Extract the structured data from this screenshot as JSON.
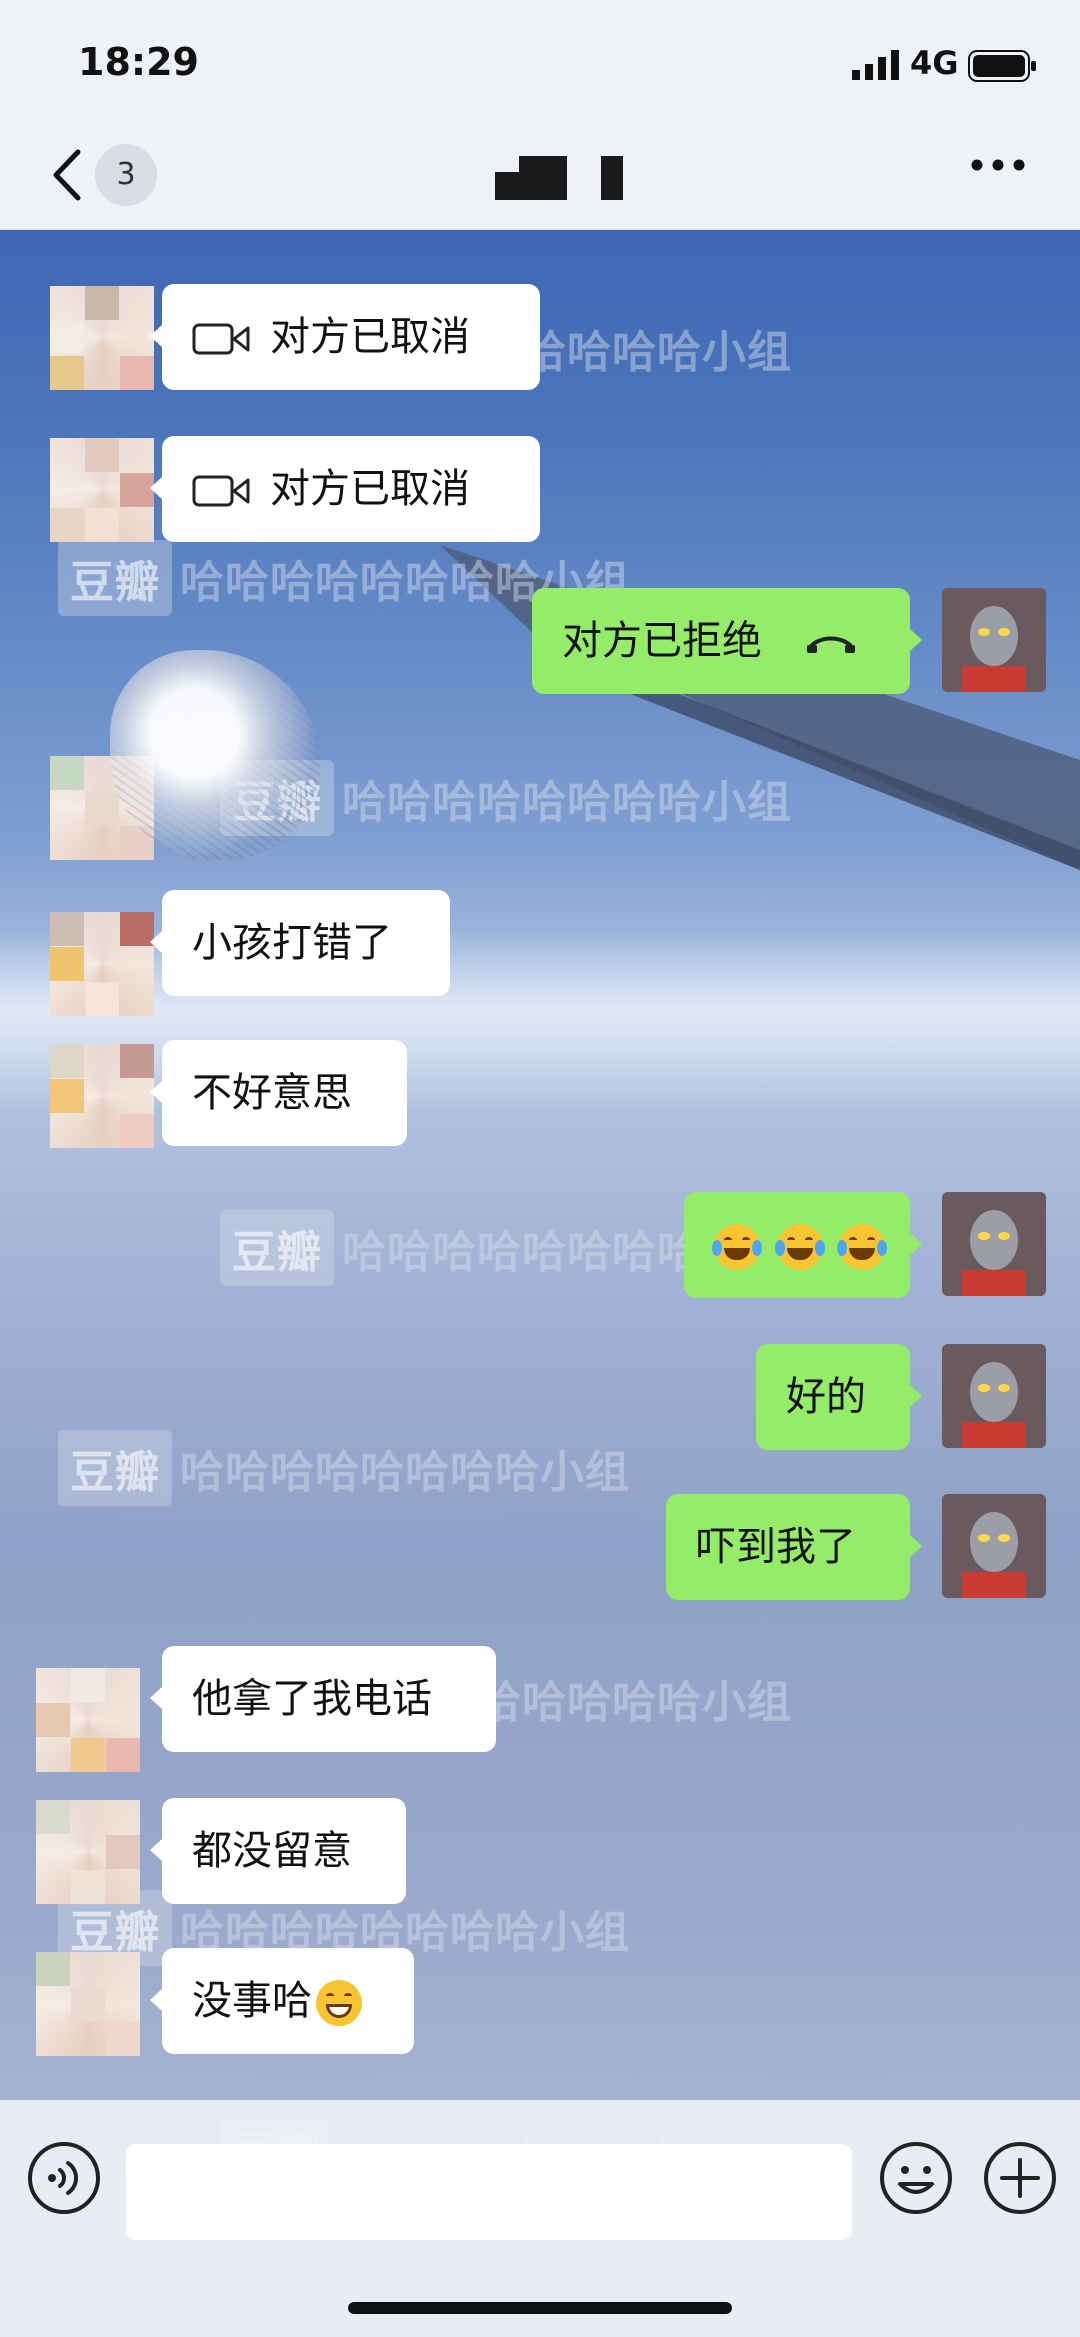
{
  "status_bar": {
    "time": "18:29",
    "network": "4G"
  },
  "header": {
    "unread_count": "3",
    "title": ""
  },
  "watermark": {
    "logo": "豆瓣",
    "text": "哈哈哈哈哈哈哈哈小组"
  },
  "messages": [
    {
      "side": "left",
      "type": "call",
      "text": "对方已取消"
    },
    {
      "side": "left",
      "type": "call",
      "text": "对方已取消"
    },
    {
      "side": "right",
      "type": "call",
      "text": "对方已拒绝"
    },
    {
      "side": "left",
      "type": "sticker",
      "text": ""
    },
    {
      "side": "left",
      "type": "text",
      "text": "小孩打错了"
    },
    {
      "side": "left",
      "type": "text",
      "text": "不好意思"
    },
    {
      "side": "right",
      "type": "emoji",
      "text": ""
    },
    {
      "side": "right",
      "type": "text",
      "text": "好的"
    },
    {
      "side": "right",
      "type": "text",
      "text": "吓到我了"
    },
    {
      "side": "left",
      "type": "text",
      "text": "他拿了我电话"
    },
    {
      "side": "left",
      "type": "text",
      "text": "都没留意"
    },
    {
      "side": "left",
      "type": "text",
      "text": "没事哈"
    }
  ],
  "input": {
    "value": ""
  },
  "colors": {
    "sent_bubble": "#95ec69",
    "received_bubble": "#ffffff",
    "header_bg": "#eef1f6"
  }
}
